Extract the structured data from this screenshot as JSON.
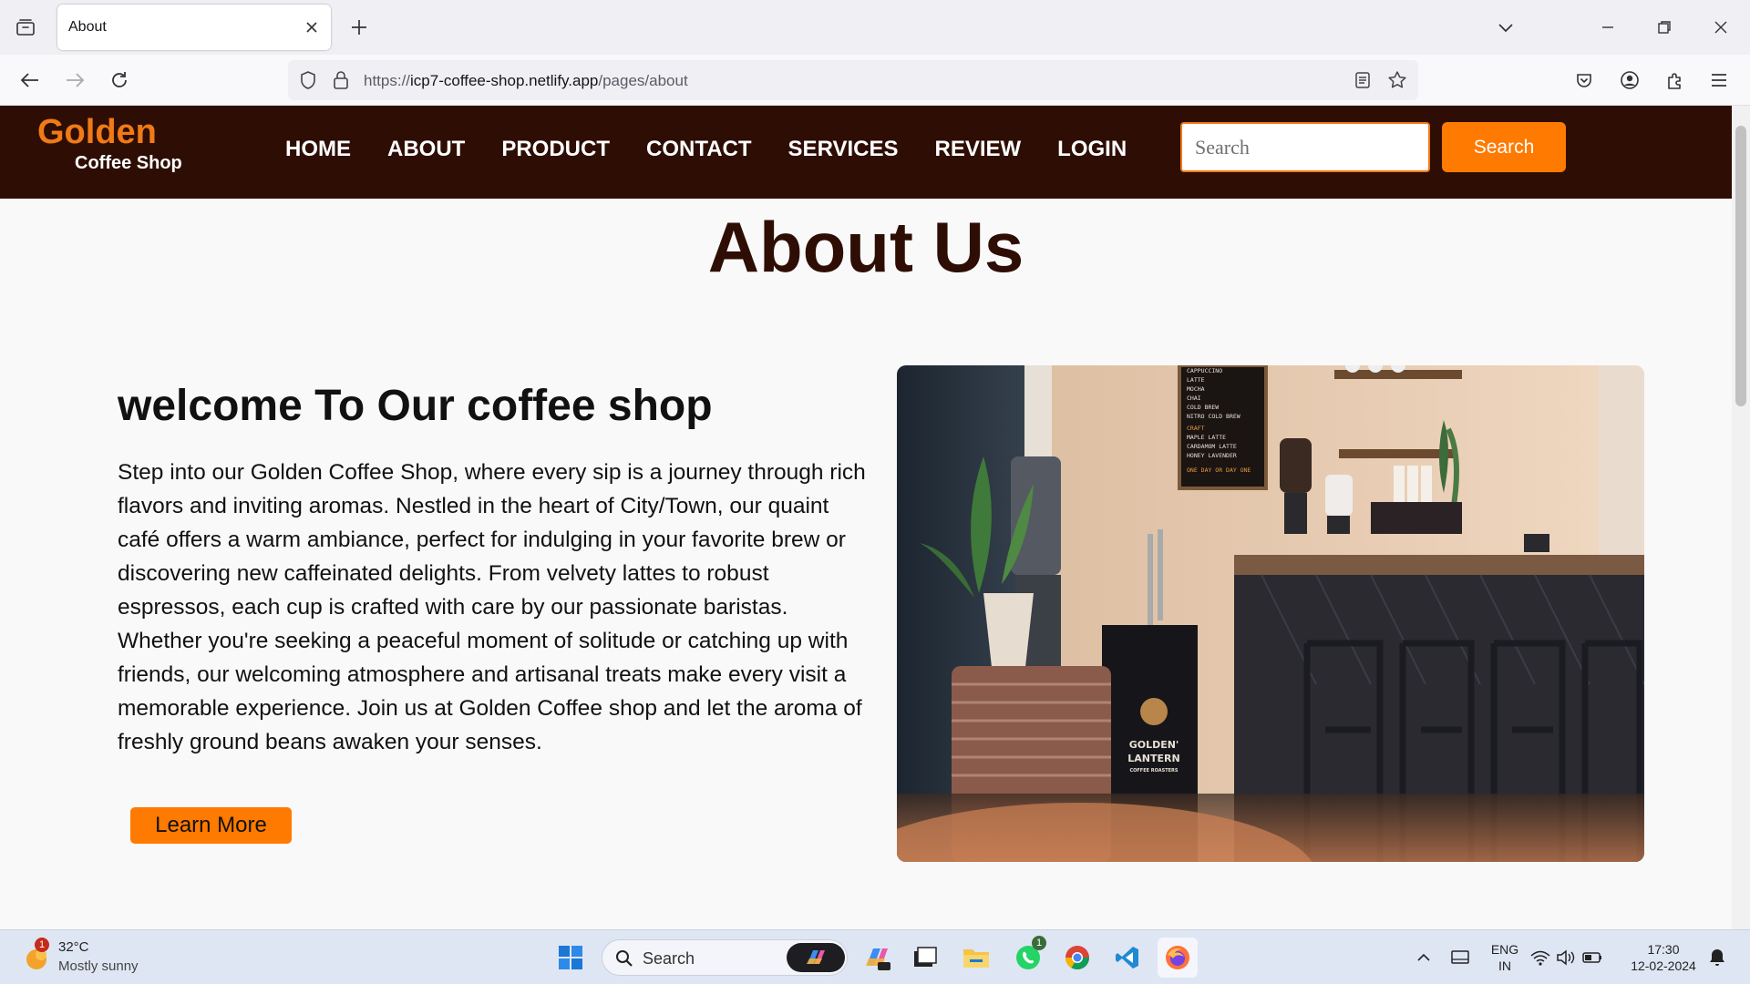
{
  "browser": {
    "tab_title": "About",
    "url_host_prefix": "https://",
    "url_host": "icp7-coffee-shop.netlify.app",
    "url_path": "/pages/about"
  },
  "site": {
    "logo_main": "Golden",
    "logo_sub": "Coffee Shop",
    "menu": [
      "HOME",
      "ABOUT",
      "PRODUCT",
      "CONTACT",
      "SERVICES",
      "REVIEW",
      "LOGIN"
    ],
    "search_placeholder": "Search",
    "search_button": "Search",
    "colors": {
      "header_bg": "#2e0e04",
      "accent": "#ff7a00",
      "logo": "#f07a16"
    }
  },
  "page": {
    "title": "About Us",
    "heading": "welcome To Our coffee shop",
    "body": "Step into our Golden Coffee Shop, where every sip is a journey through rich flavors and inviting aromas. Nestled in the heart of City/Town, our quaint café offers a warm ambiance, perfect for indulging in your favorite brew or discovering new caffeinated delights. From velvety lattes to robust espressos, each cup is crafted with care by our passionate baristas. Whether you're seeking a peaceful moment of solitude or catching up with friends, our welcoming atmosphere and artisanal treats make every visit a memorable experience. Join us at Golden Coffee shop and let the aroma of freshly ground beans awaken your senses.",
    "learn_more": "Learn More",
    "photo": {
      "menu_board": [
        "CAPPUCCINO",
        "LATTE",
        "MOCHA",
        "CHAI",
        "COLD BREW",
        "NITRO COLD BREW",
        "CRAFT",
        "MAPLE LATTE",
        "CARDAMOM LATTE",
        "HONEY LAVENDER",
        "ONE DAY OR DAY ONE"
      ],
      "brand_line1": "GOLDEN'",
      "brand_line2": "LANTERN",
      "brand_line3": "COFFEE ROASTERS"
    }
  },
  "taskbar": {
    "weather_temp": "32°C",
    "weather_desc": "Mostly sunny",
    "weather_badge": "1",
    "search_label": "Search",
    "whatsapp_badge": "1",
    "lang_line1": "ENG",
    "lang_line2": "IN",
    "time": "17:30",
    "date": "12-02-2024"
  }
}
